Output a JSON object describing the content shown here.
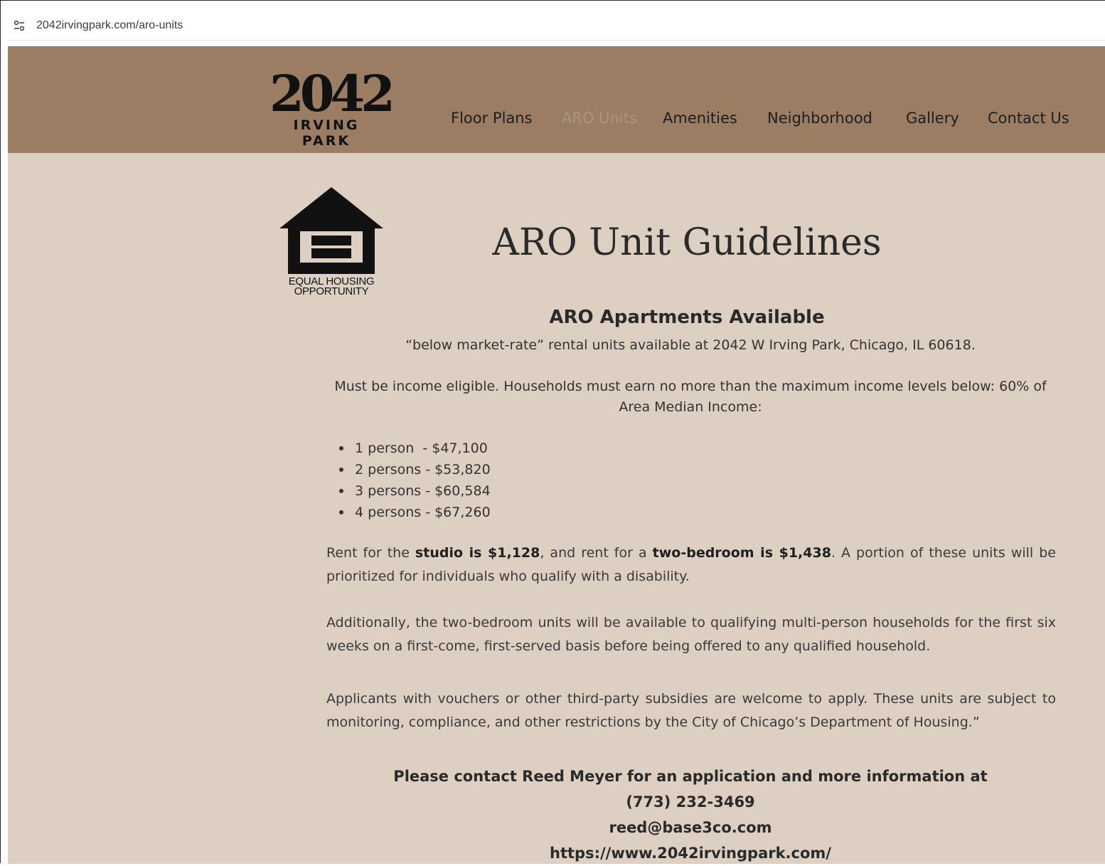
{
  "browser": {
    "url": "2042irvingpark.com/aro-units",
    "site_info_icon": "tune-icon"
  },
  "header": {
    "logo_number": "2042",
    "logo_subtitle": "IRVING PARK",
    "nav": [
      {
        "label": "Floor Plans",
        "active": false
      },
      {
        "label": "ARO Units",
        "active": true
      },
      {
        "label": "Amenities",
        "active": false
      },
      {
        "label": "Neighborhood",
        "active": false
      },
      {
        "label": "Gallery",
        "active": false
      },
      {
        "label": "Contact Us",
        "active": false
      }
    ],
    "background_color": "#9b7d63"
  },
  "main": {
    "eho_logo_text_line1": "EQUAL HOUSING",
    "eho_logo_text_line2": "OPPORTUNITY",
    "title": "ARO Unit Guidelines",
    "subheading": "ARO Apartments Available",
    "intro": "“below market-rate” rental units available at 2042 W Irving Park, Chicago, IL 60618.",
    "eligibility": "Must be income eligible. Households must earn no more than the maximum income levels below: 60% of Area Median Income:",
    "income_levels": [
      {
        "household": "1 person",
        "separator": "  - ",
        "amount": "$47,100"
      },
      {
        "household": "2 persons",
        "separator": " - ",
        "amount": "$53,820"
      },
      {
        "household": "3 persons",
        "separator": " - ",
        "amount": "$60,584"
      },
      {
        "household": "4 persons",
        "separator": " - ",
        "amount": "$67,260"
      }
    ],
    "rent": {
      "prefix": "Rent for the ",
      "studio": "studio is $1,128",
      "middle": ", and rent for a ",
      "two_bedroom": "two-bedroom is $1,438",
      "suffix": ". A portion of these units will be prioritized for individuals who qualify with a disability."
    },
    "two_bedroom_note": "Additionally, the two-bedroom units will be available to qualifying multi-person households for the first six weeks on a first-come, first-served basis before being offered to any qualified household.",
    "voucher_note": "Applicants with vouchers or other third-party subsidies are welcome to apply. These units are subject to monitoring, compliance, and other restrictions by the City of Chicago’s Department of Housing.”",
    "contact": {
      "line1": "Please contact Reed Meyer for an application and more information at",
      "phone": "(773) 232-3469",
      "email": "reed@base3co.com",
      "website": "https://www.2042irvingpark.com/"
    },
    "background_color": "#ddd0c3"
  }
}
